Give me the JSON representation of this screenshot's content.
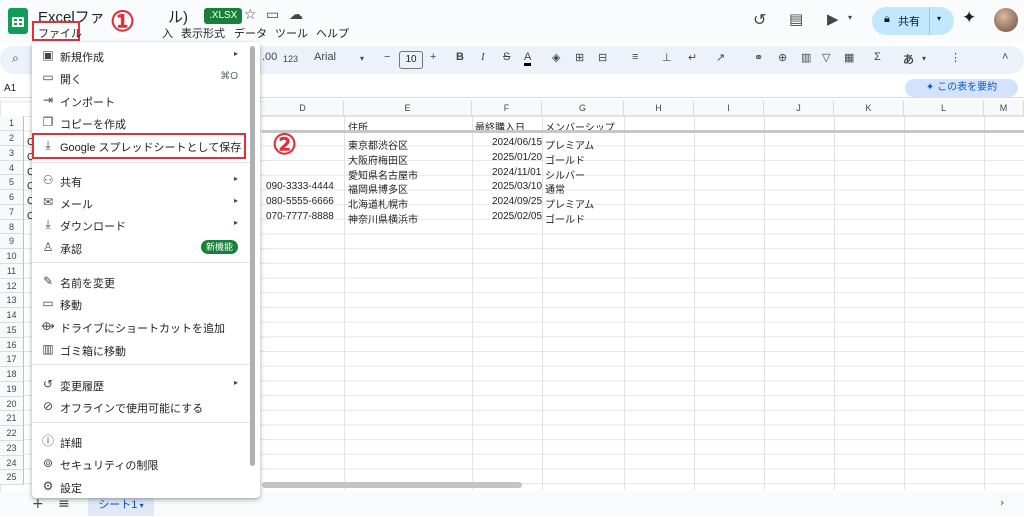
{
  "header": {
    "title": "Excelファ",
    "title_tail": "ル)",
    "badge": ".XLSX",
    "menus": [
      "ファイル",
      "入",
      "表示形式",
      "データ",
      "ツール",
      "ヘルプ"
    ],
    "share_label": "共有"
  },
  "toolbar": {
    "number_format": ".00",
    "format_123": "123",
    "font": "Arial",
    "font_size": "10"
  },
  "formula_bar": {
    "name_box": "A1",
    "summarize_label": "この表を要約"
  },
  "grid": {
    "columns": [
      "D",
      "E",
      "F",
      "G",
      "H",
      "I",
      "J",
      "K",
      "L",
      "M"
    ],
    "rows": [
      "1",
      "2",
      "3",
      "4",
      "5",
      "6",
      "7",
      "8",
      "9",
      "10",
      "11",
      "12",
      "13",
      "14",
      "15",
      "16",
      "17",
      "18",
      "19",
      "20",
      "21",
      "22",
      "23",
      "24",
      "25",
      "26"
    ],
    "header_row": {
      "address": "住所",
      "date": "最終購入日",
      "membership": "メンバーシップ"
    },
    "data": [
      {
        "phone": "",
        "address": "東京都渋谷区",
        "date": "2024/06/15",
        "membership": "プレミアム"
      },
      {
        "phone": "",
        "address": "大阪府梅田区",
        "date": "2025/01/20",
        "membership": "ゴールド"
      },
      {
        "phone": "",
        "address": "愛知県名古屋市",
        "date": "2024/11/01",
        "membership": "シルバー"
      },
      {
        "phone": "090-3333-4444",
        "address": "福岡県博多区",
        "date": "2025/03/10",
        "membership": "通常"
      },
      {
        "phone": "080-5555-6666",
        "address": "北海道札幌市",
        "date": "2024/09/25",
        "membership": "プレミアム"
      },
      {
        "phone": "070-7777-8888",
        "address": "神奈川県横浜市",
        "date": "2025/02/05",
        "membership": "ゴールド"
      }
    ],
    "col_c_fragments": [
      "C",
      "C",
      "C",
      "C",
      "C",
      "C"
    ]
  },
  "file_menu": {
    "items": [
      {
        "icon": "new-icon",
        "label": "新規作成",
        "arrow": "▸"
      },
      {
        "icon": "open-folder-icon",
        "label": "開く",
        "shortcut": "⌘O"
      },
      {
        "icon": "import-icon",
        "label": "インポート"
      },
      {
        "icon": "copy-icon",
        "label": "コピーを作成"
      },
      {
        "icon": "save-download-icon",
        "label": "Google スプレッドシートとして保存"
      },
      {
        "icon": "share-person-icon",
        "label": "共有",
        "arrow": "▸"
      },
      {
        "icon": "mail-icon",
        "label": "メール",
        "arrow": "▸"
      },
      {
        "icon": "download-icon",
        "label": "ダウンロード",
        "arrow": "▸"
      },
      {
        "icon": "approval-icon",
        "label": "承認",
        "badge": "新機能"
      },
      {
        "icon": "rename-pencil-icon",
        "label": "名前を変更"
      },
      {
        "icon": "move-folder-icon",
        "label": "移動"
      },
      {
        "icon": "drive-shortcut-icon",
        "label": "ドライブにショートカットを追加"
      },
      {
        "icon": "trash-icon",
        "label": "ゴミ箱に移動"
      },
      {
        "icon": "history-icon",
        "label": "変更履歴",
        "arrow": "▸"
      },
      {
        "icon": "offline-icon",
        "label": "オフラインで使用可能にする"
      },
      {
        "icon": "info-icon",
        "label": "詳細"
      },
      {
        "icon": "security-icon",
        "label": "セキュリティの制限"
      },
      {
        "icon": "settings-gear-icon",
        "label": "設定"
      }
    ]
  },
  "annotations": {
    "step1": "①",
    "step2": "②"
  },
  "sheets": {
    "active_tab": "シート1",
    "add": "+",
    "list": "≡"
  },
  "colors": {
    "sheets_green": "#0f9d58",
    "highlight_red": "#e0303a",
    "share_blue": "#c2e7ff",
    "badge_green": "#188038"
  }
}
